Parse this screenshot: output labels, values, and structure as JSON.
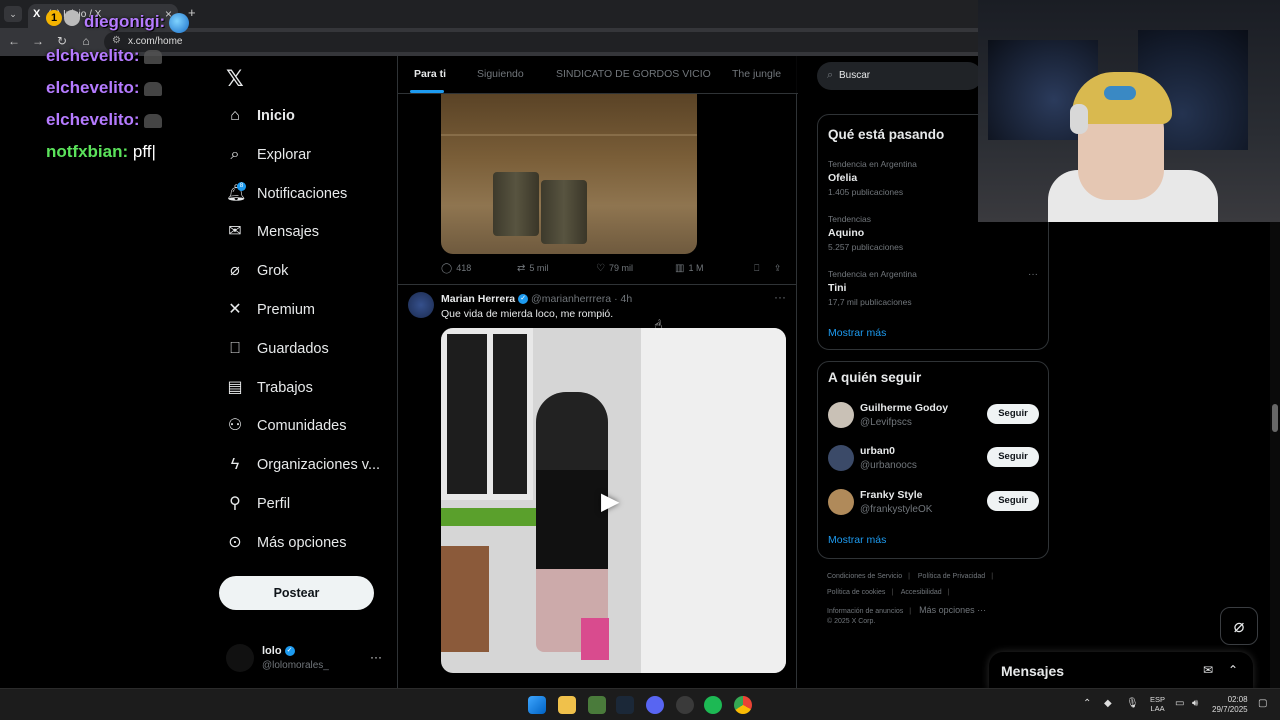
{
  "browser": {
    "tab_title": "(8) Inicio / X",
    "url": "x.com/home"
  },
  "chat": [
    {
      "user": "diegonigi",
      "sep": ":",
      "msg": ""
    },
    {
      "user": "elchevelito",
      "sep": ":",
      "msg": ""
    },
    {
      "user": "elchevelito",
      "sep": ":",
      "msg": ""
    },
    {
      "user": "elchevelito",
      "sep": ":",
      "msg": ""
    },
    {
      "user": "notfxbian",
      "sep": ":",
      "msg": " pff|"
    }
  ],
  "sidebar": {
    "items": [
      {
        "label": "Inicio",
        "icon": "home-icon"
      },
      {
        "label": "Explorar",
        "icon": "search-icon"
      },
      {
        "label": "Notificaciones",
        "icon": "bell-icon"
      },
      {
        "label": "Mensajes",
        "icon": "mail-icon"
      },
      {
        "label": "Grok",
        "icon": "grok-icon"
      },
      {
        "label": "Premium",
        "icon": "x-icon"
      },
      {
        "label": "Guardados",
        "icon": "bookmark-icon"
      },
      {
        "label": "Trabajos",
        "icon": "briefcase-icon"
      },
      {
        "label": "Comunidades",
        "icon": "people-icon"
      },
      {
        "label": "Organizaciones v...",
        "icon": "lightning-icon"
      },
      {
        "label": "Perfil",
        "icon": "person-icon"
      },
      {
        "label": "Más opciones",
        "icon": "more-circle-icon"
      }
    ],
    "notif_count": "8",
    "post_label": "Postear",
    "profile_name": "lolo",
    "profile_handle": "@lolomorales_"
  },
  "feed": {
    "tabs": [
      "Para ti",
      "Siguiendo",
      "SINDICATO DE GORDOS VICIO",
      "The jungle"
    ],
    "post1_actions": {
      "replies": "418",
      "reposts": "5 mil",
      "likes": "79 mil",
      "views": "1 M"
    },
    "post2": {
      "name": "Marian Herrera",
      "handle": "@marianherrrera",
      "time": "· 4h",
      "text": "Que vida de mierda loco, me rompió."
    }
  },
  "right": {
    "search_placeholder": "Buscar",
    "trending_title": "Qué está pasando",
    "trends": [
      {
        "context": "Tendencia en Argentina",
        "name": "Ofelia",
        "count": "1.405 publicaciones"
      },
      {
        "context": "Tendencias",
        "name": "Aquino",
        "count": "5.257 publicaciones"
      },
      {
        "context": "Tendencia en Argentina",
        "name": "Tini",
        "count": "17,7 mil publicaciones"
      }
    ],
    "show_more": "Mostrar más",
    "follow_title": "A quién seguir",
    "follow": [
      {
        "name": "Guilherme Godoy",
        "handle": "@Levifpscs",
        "button": "Seguir"
      },
      {
        "name": "urban0",
        "handle": "@urbanoocs",
        "button": "Seguir"
      },
      {
        "name": "Franky Style",
        "handle": "@frankystyleOK",
        "button": "Seguir"
      }
    ],
    "footer": {
      "terms": "Condiciones de Servicio",
      "privacy": "Política de Privacidad",
      "cookies": "Política de cookies",
      "accessibility": "Accesibilidad",
      "ads": "Información de anuncios",
      "more": "Más opciones ···",
      "copyright": "© 2025 X Corp."
    }
  },
  "messages_dock": {
    "title": "Mensajes"
  },
  "taskbar": {
    "lang_top": "ESP",
    "lang_bottom": "LAA",
    "time": "02:08",
    "date": "29/7/2025"
  }
}
